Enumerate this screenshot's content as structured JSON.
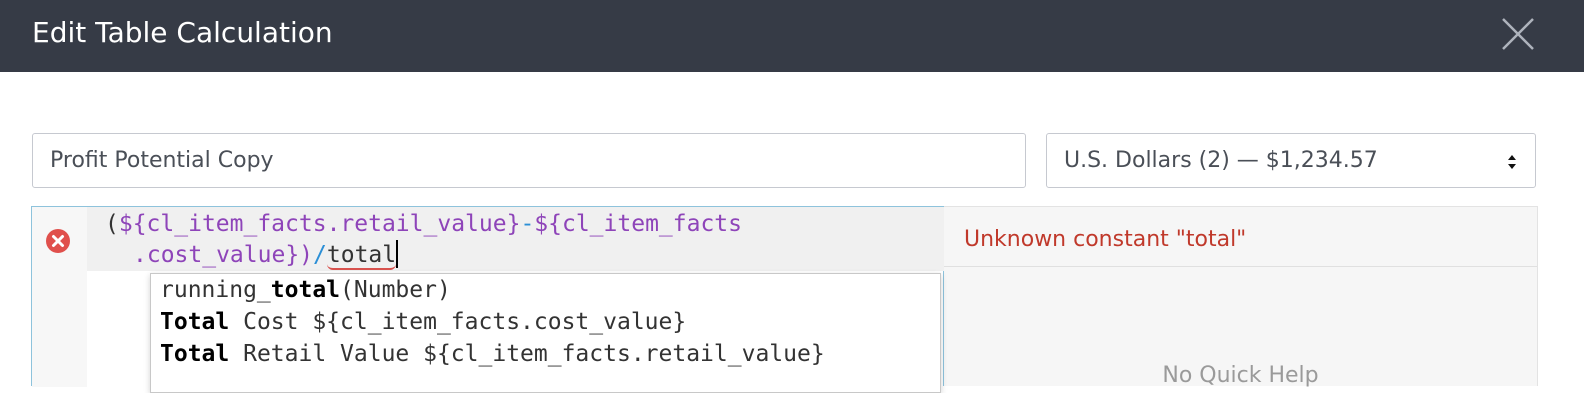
{
  "dialog": {
    "title": "Edit Table Calculation",
    "close_icon": "close-icon"
  },
  "name_field": {
    "value": "Profit Potential Copy"
  },
  "format_select": {
    "selected": "U.S. Dollars (2) — $1,234.57",
    "icon": "up-down-caret-icon"
  },
  "editor": {
    "error_icon": "error-circle-x-icon",
    "line1": {
      "open_paren": "(",
      "var1": "${cl_item_facts.retail_value}",
      "op": "-",
      "var2_start": "${cl_item_facts"
    },
    "line2": {
      "var2_end": ".cost_value}",
      "close_paren": ")",
      "op": "/",
      "error_token": "total"
    }
  },
  "autocomplete": {
    "items": [
      {
        "prefix": "running_",
        "match": "total",
        "rest": "(Number)"
      },
      {
        "prefix": "",
        "match": "Total",
        "rest": " Cost ${cl_item_facts.cost_value}"
      },
      {
        "prefix": "",
        "match": "Total",
        "rest": " Retail Value ${cl_item_facts.retail_value}"
      }
    ]
  },
  "side_panel": {
    "error_message": "Unknown constant \"total\"",
    "help_text": "No Quick Help"
  },
  "colors": {
    "header_bg": "#363b46",
    "error_red": "#c0392b",
    "variable_purple": "#8e44b9",
    "operator_blue": "#2b8fd6",
    "editor_focus_border": "#8ec3dc"
  }
}
